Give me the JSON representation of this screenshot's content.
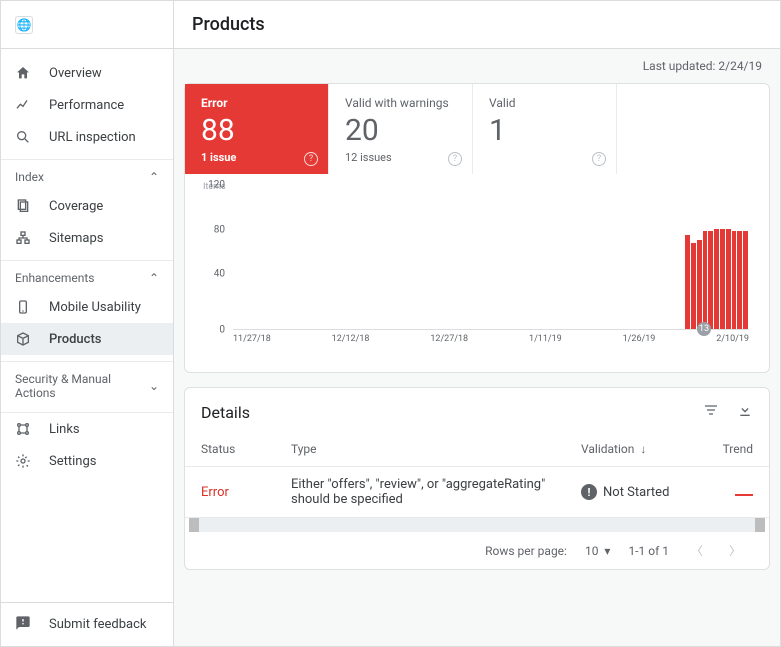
{
  "header": {
    "title": "Products",
    "updated": "Last updated: 2/24/19"
  },
  "sidebar": {
    "items": [
      {
        "icon": "home",
        "label": "Overview"
      },
      {
        "icon": "trend",
        "label": "Performance"
      },
      {
        "icon": "search",
        "label": "URL inspection"
      }
    ],
    "sections": [
      {
        "title": "Index",
        "expanded": true,
        "items": [
          {
            "icon": "coverage",
            "label": "Coverage"
          },
          {
            "icon": "sitemap",
            "label": "Sitemaps"
          }
        ]
      },
      {
        "title": "Enhancements",
        "expanded": true,
        "items": [
          {
            "icon": "mobile",
            "label": "Mobile Usability"
          },
          {
            "icon": "product",
            "label": "Products",
            "active": true
          }
        ]
      },
      {
        "title": "Security & Manual Actions",
        "expanded": false,
        "items": []
      }
    ],
    "bottom": [
      {
        "icon": "links",
        "label": "Links"
      },
      {
        "icon": "settings",
        "label": "Settings"
      }
    ],
    "feedback": "Submit feedback"
  },
  "stats": [
    {
      "kind": "error",
      "label": "Error",
      "value": "88",
      "sub": "1 issue"
    },
    {
      "kind": "warn",
      "label": "Valid with warnings",
      "value": "20",
      "sub": "12 issues"
    },
    {
      "kind": "valid",
      "label": "Valid",
      "value": "1",
      "sub": ""
    }
  ],
  "chart_data": {
    "type": "bar",
    "title": "Items",
    "ylabel": "Items",
    "ylim": [
      0,
      120
    ],
    "yticks": [
      0,
      40,
      80,
      120
    ],
    "x_ticks": [
      "11/27/18",
      "12/12/18",
      "12/27/18",
      "1/11/19",
      "1/26/19",
      "2/10/19"
    ],
    "series": [
      {
        "name": "Error",
        "color": "#e53935",
        "values": [
          0,
          0,
          0,
          0,
          0,
          0,
          0,
          0,
          0,
          0,
          0,
          0,
          0,
          0,
          0,
          0,
          0,
          0,
          0,
          0,
          0,
          0,
          0,
          0,
          0,
          0,
          0,
          0,
          0,
          0,
          0,
          0,
          0,
          0,
          0,
          0,
          0,
          0,
          0,
          0,
          0,
          0,
          0,
          0,
          0,
          0,
          0,
          0,
          0,
          0,
          0,
          0,
          0,
          0,
          0,
          0,
          0,
          0,
          0,
          0,
          0,
          0,
          0,
          0,
          0,
          0,
          0,
          0,
          0,
          0,
          0,
          0,
          0,
          0,
          0,
          0,
          0,
          0,
          85,
          78,
          80,
          88,
          88,
          90,
          90,
          90,
          88,
          88,
          88
        ]
      }
    ],
    "marker": "13"
  },
  "details": {
    "title": "Details",
    "columns": {
      "status": "Status",
      "type": "Type",
      "validation": "Validation",
      "trend": "Trend"
    },
    "sort_indicator": "↓",
    "rows": [
      {
        "status": "Error",
        "type": "Either \"offers\", \"review\", or \"aggregateRating\" should be specified",
        "validation": "Not Started"
      }
    ],
    "pager": {
      "label": "Rows per page:",
      "size": "10",
      "range": "1-1 of 1"
    }
  }
}
